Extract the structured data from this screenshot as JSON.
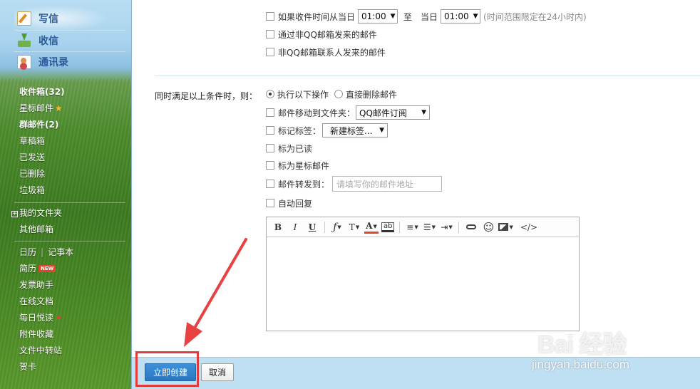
{
  "sidebar": {
    "compose_label": "写信",
    "inbox_label": "收信",
    "contacts_label": "通讯录",
    "folders": {
      "inbox": "收件箱(32)",
      "starred": "星标邮件",
      "group": "群邮件(2)",
      "drafts": "草稿箱",
      "sent": "已发送",
      "deleted": "已删除",
      "spam": "垃圾箱"
    },
    "my_folders": "我的文件夹",
    "other_mailboxes": "其他邮箱",
    "calendar": "日历",
    "notes": "记事本",
    "resume": "简历",
    "new_badge": "NEW",
    "invoice": "发票助手",
    "online_docs": "在线文档",
    "daily_reading": "每日悦读",
    "attachments": "附件收藏",
    "file_transfer": "文件中转站",
    "cards": "贺卡"
  },
  "conditions": {
    "time_prefix": "如果收件时间从当日",
    "time_from": "01:00",
    "time_to_word": "至",
    "time_to_prefix": "当日",
    "time_to": "01:00",
    "time_hint": "(时间范围限定在24小时内)",
    "via_non_qq": "通过非QQ邮箱发来的邮件",
    "non_contact": "非QQ邮箱联系人发来的邮件"
  },
  "actions": {
    "label": "同时满足以上条件时，则：",
    "execute_option": "执行以下操作",
    "delete_option": "直接删除邮件",
    "move_to_folder": "邮件移动到文件夹：",
    "folder_value": "QQ邮件订阅",
    "tag_label": "标记标签：",
    "tag_value": "新建标签...",
    "mark_read": "标为已读",
    "mark_starred": "标为星标邮件",
    "forward_to": "邮件转发到：",
    "forward_placeholder": "请填写你的邮件地址",
    "auto_reply": "自动回复"
  },
  "toolbar": {
    "bold": "B",
    "italic": "I",
    "underline": "U",
    "font": "ƒ",
    "size": "T",
    "color": "A",
    "bg_color": "ab",
    "source": "</>"
  },
  "footer": {
    "create_label": "立即创建",
    "cancel_label": "取消"
  },
  "watermark": {
    "brand": "Bai 经验",
    "url": "jingyan.baidu.com"
  },
  "colors": {
    "primary_button": "#2f80c8",
    "highlight": "#e03c3c",
    "footer_bg": "#bfe0f3"
  }
}
